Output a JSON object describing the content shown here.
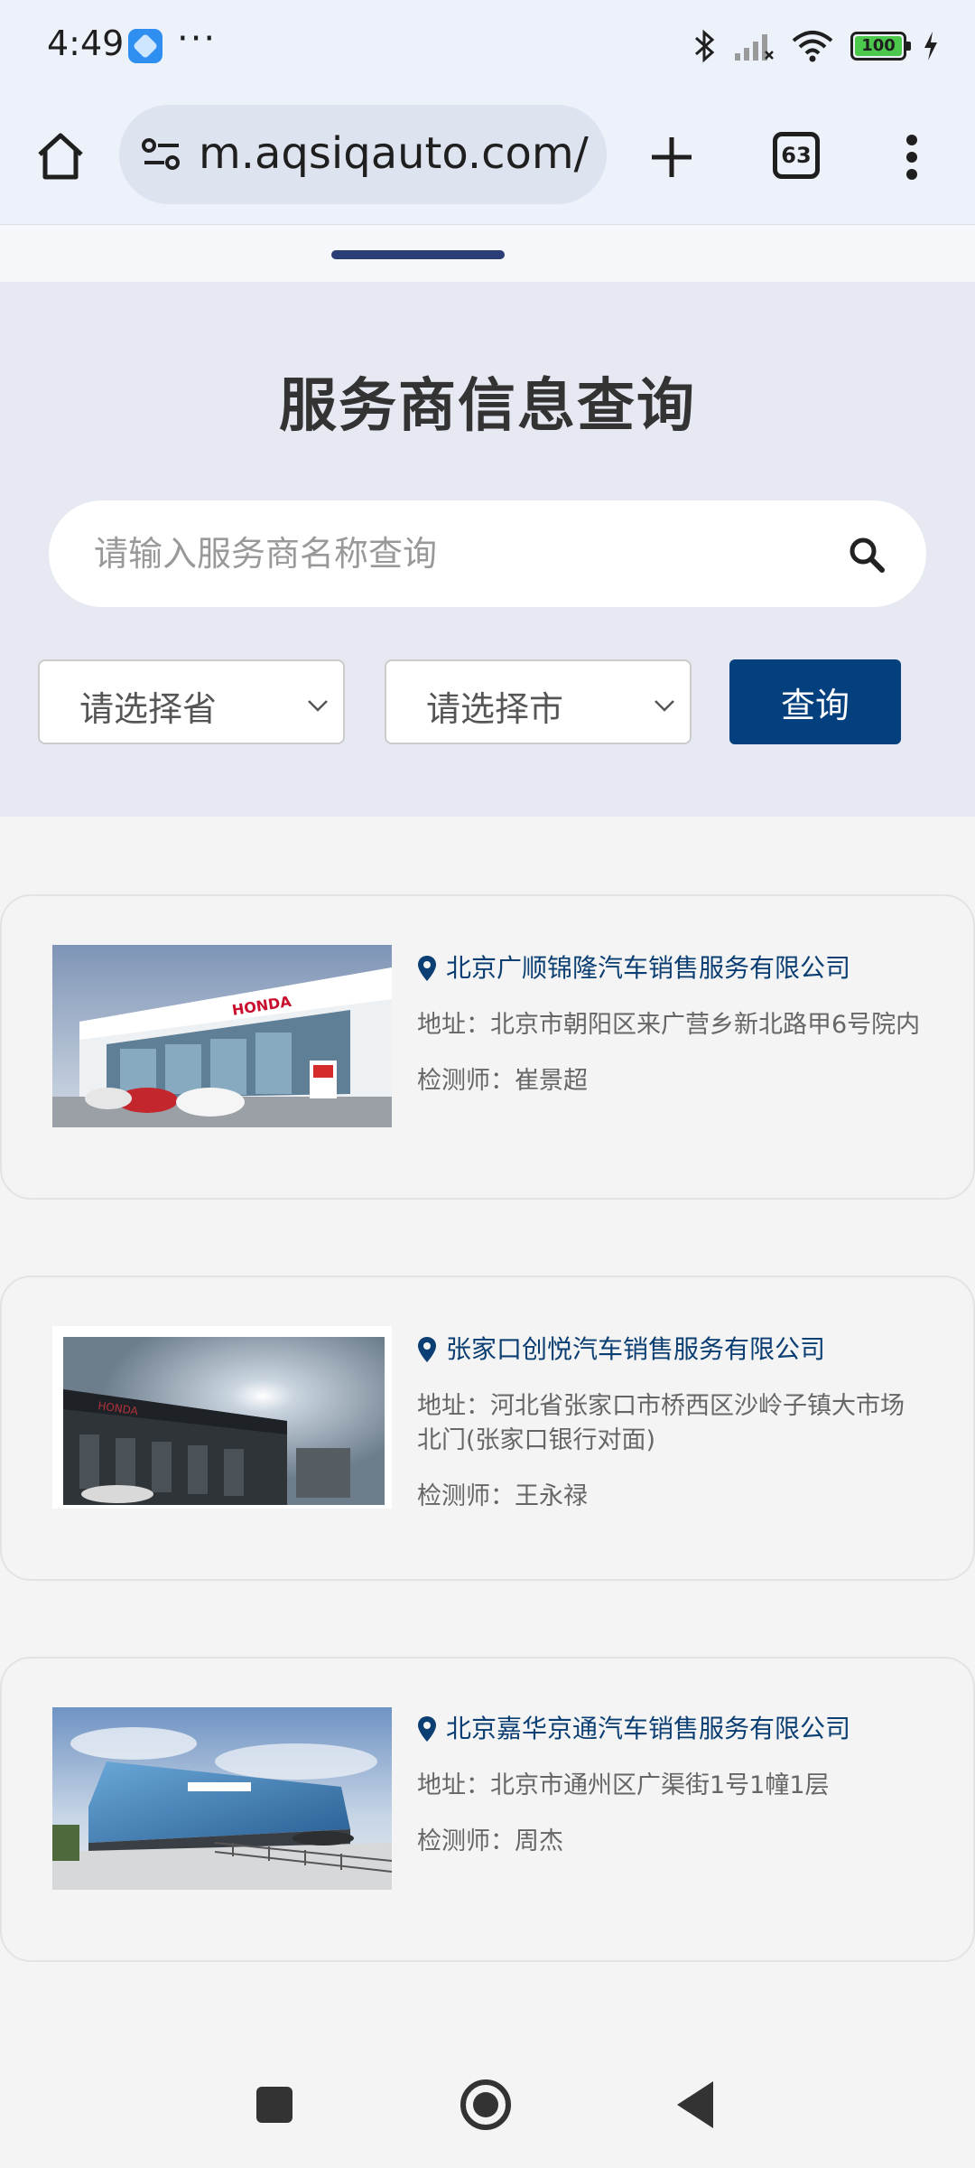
{
  "status_bar": {
    "time": "4:49",
    "more": "···",
    "battery": "100"
  },
  "browser": {
    "url": "m.aqsiqauto.com/",
    "tab_count": "63"
  },
  "page": {
    "title": "服务商信息查询",
    "search_placeholder": "请输入服务商名称查询",
    "province_select": "请选择省",
    "city_select": "请选择市",
    "query_button": "查询"
  },
  "providers": [
    {
      "name": "北京广顺锦隆汽车销售服务有限公司",
      "address": "地址：北京市朝阳区来广营乡新北路甲6号院内",
      "inspector": "检测师：崔景超"
    },
    {
      "name": "张家口创悦汽车销售服务有限公司",
      "address": "地址：河北省张家口市桥西区沙岭子镇大市场北门(张家口银行对面)",
      "inspector": "检测师：王永禄"
    },
    {
      "name": "北京嘉华京通汽车销售服务有限公司",
      "address": "地址：北京市通州区广渠街1号1幢1层",
      "inspector": "检测师：周杰"
    }
  ],
  "colors": {
    "accent": "#04407e",
    "link": "#0b3e72",
    "hero_bg": "#e6e9f1",
    "tab_indicator": "#2b3d75"
  }
}
